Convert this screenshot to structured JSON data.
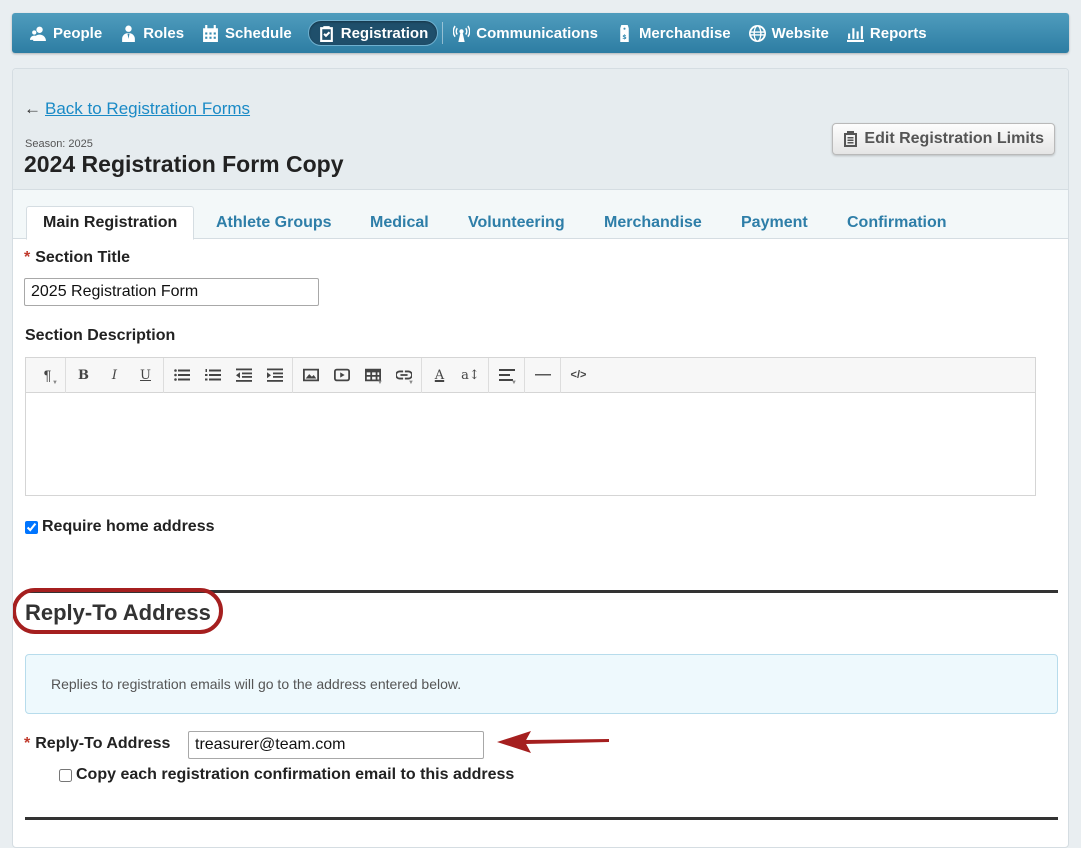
{
  "nav": {
    "items": [
      {
        "label": "People",
        "icon": "people-icon"
      },
      {
        "label": "Roles",
        "icon": "roles-icon"
      },
      {
        "label": "Schedule",
        "icon": "calendar-icon"
      },
      {
        "label": "Registration",
        "icon": "clipboard-check-icon",
        "active": true
      },
      {
        "label": "Communications",
        "icon": "antenna-icon"
      },
      {
        "label": "Merchandise",
        "icon": "price-tag-icon"
      },
      {
        "label": "Website",
        "icon": "globe-icon"
      },
      {
        "label": "Reports",
        "icon": "bar-chart-icon"
      }
    ]
  },
  "header": {
    "back_arrow": "←",
    "back_link": "Back to Registration Forms",
    "season": "Season: 2025",
    "title": "2024 Registration Form Copy",
    "edit_limits_label": "Edit Registration Limits"
  },
  "tabs": [
    {
      "label": "Main Registration",
      "active": true
    },
    {
      "label": "Athlete Groups"
    },
    {
      "label": "Medical"
    },
    {
      "label": "Volunteering"
    },
    {
      "label": "Merchandise"
    },
    {
      "label": "Payment"
    },
    {
      "label": "Confirmation"
    }
  ],
  "form": {
    "required_mark": "*",
    "section_title_label": "Section Title",
    "section_title_value": "2025 Registration Form",
    "section_description_label": "Section Description",
    "require_home_address_label": "Require home address",
    "require_home_address_checked": true
  },
  "editor_toolbar": {
    "buttons": [
      "paragraph",
      "bold",
      "italic",
      "underline",
      "bulleted-list",
      "numbered-list",
      "outdent",
      "indent",
      "image",
      "video",
      "table",
      "link",
      "font-color",
      "font-size",
      "align",
      "horizontal-rule",
      "code-view"
    ],
    "glyphs": {
      "paragraph": "¶",
      "bold": "B",
      "italic": "I",
      "underline": "U",
      "font_color": "A",
      "font_size": "a↕",
      "code": "</>"
    }
  },
  "reply_to": {
    "heading": "Reply-To Address",
    "info": "Replies to registration emails will go to the address entered below.",
    "field_label": "Reply-To Address",
    "field_value": "treasurer@team.com",
    "copy_label": "Copy each registration confirmation email to this address",
    "copy_checked": false
  },
  "colors": {
    "nav_bar": "#3a8db2",
    "link": "#1a8ac6",
    "tab": "#2e7ea8",
    "annotation": "#a51f1f",
    "required": "#c0392b"
  }
}
